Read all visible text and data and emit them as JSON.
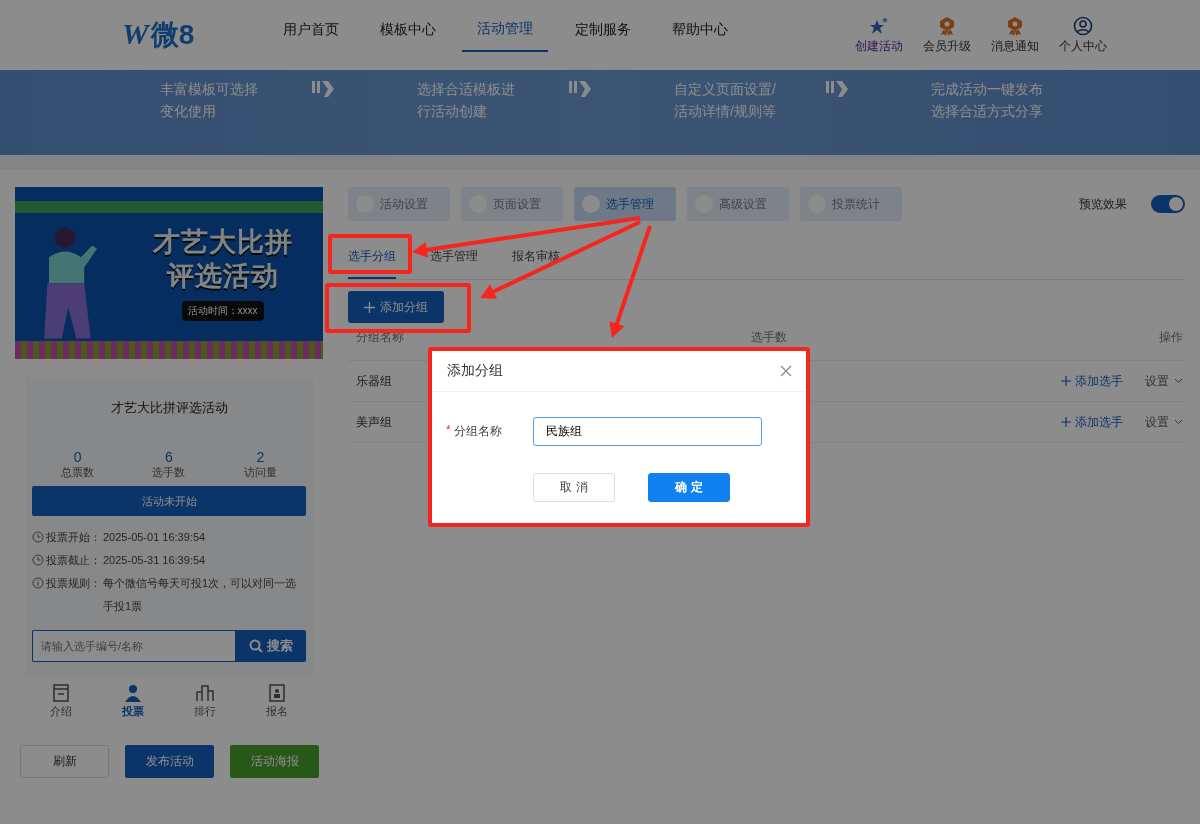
{
  "header": {
    "logo_mark": "W",
    "logo_text": "微8",
    "nav": [
      {
        "label": "用户首页",
        "selected": false
      },
      {
        "label": "模板中心",
        "selected": false
      },
      {
        "label": "活动管理",
        "selected": true
      },
      {
        "label": "定制服务",
        "selected": false
      },
      {
        "label": "帮助中心",
        "selected": false
      }
    ],
    "actions": [
      {
        "kind": "star",
        "label": "创建活动"
      },
      {
        "kind": "badge",
        "label": "会员升级"
      },
      {
        "kind": "badge",
        "label": "消息通知"
      },
      {
        "kind": "user",
        "label": "个人中心"
      }
    ]
  },
  "steps": [
    {
      "lines": [
        "丰富模板可选择",
        "变化使用"
      ]
    },
    {
      "lines": [
        "选择合适模板进",
        "行活动创建"
      ]
    },
    {
      "lines": [
        "自定义页面设置/",
        "活动详情/规则等"
      ]
    },
    {
      "lines": [
        "完成活动一键发布",
        "选择合适方式分享"
      ]
    }
  ],
  "preview": {
    "poster": {
      "title_lines": [
        "才艺大比拼",
        "评选活动"
      ],
      "time": "活动时间：xxxx"
    },
    "title": "才艺大比拼评选活动",
    "stats": [
      {
        "value": "0",
        "label": "总票数"
      },
      {
        "value": "6",
        "label": "选手数"
      },
      {
        "value": "2",
        "label": "访问量"
      }
    ],
    "status": "活动未开始",
    "info": [
      {
        "kind": "clock",
        "label": "投票开始：",
        "value": "2025-05-01 16:39:54"
      },
      {
        "kind": "clock",
        "label": "投票截止：",
        "value": "2025-05-31 16:39:54"
      },
      {
        "kind": "info",
        "label": "投票规则：",
        "value": "每个微信号每天可投1次，可以对同一选手投1票"
      }
    ],
    "search": {
      "placeholder": "请输入选手编号/名称",
      "button": "搜索"
    },
    "tabs": [
      {
        "kind": "intro",
        "label": "介绍",
        "selected": false
      },
      {
        "kind": "vote",
        "label": "投票",
        "selected": true
      },
      {
        "kind": "rank",
        "label": "排行",
        "selected": false
      },
      {
        "kind": "signup",
        "label": "报名",
        "selected": false
      }
    ],
    "buttons": [
      {
        "kind": "plain",
        "label": "刷新"
      },
      {
        "kind": "primary",
        "label": "发布活动"
      },
      {
        "kind": "success",
        "label": "活动海报"
      }
    ]
  },
  "settings": {
    "tabs": [
      {
        "label": "活动设置",
        "selected": false
      },
      {
        "label": "页面设置",
        "selected": false
      },
      {
        "label": "选手管理",
        "selected": true
      },
      {
        "label": "高级设置",
        "selected": false
      },
      {
        "label": "投票统计",
        "selected": false
      }
    ],
    "preview_toggle": {
      "label": "预览效果",
      "on": true
    },
    "subtabs": [
      {
        "label": "选手分组",
        "selected": true
      },
      {
        "label": "选手管理",
        "selected": false
      },
      {
        "label": "报名审核",
        "selected": false
      }
    ],
    "add_button": "添加分组",
    "table": {
      "columns": [
        "分组名称",
        "选手数",
        "操作"
      ],
      "rows": [
        {
          "name": "乐器组",
          "add_player": "添加选手",
          "settings": "设置"
        },
        {
          "name": "美声组",
          "add_player": "添加选手",
          "settings": "设置"
        }
      ]
    }
  },
  "dialog": {
    "title": "添加分组",
    "field": {
      "required_mark": "*",
      "label": "分组名称",
      "value": "民族组"
    },
    "buttons": [
      {
        "kind": "cancel",
        "label": "取 消"
      },
      {
        "kind": "confirm",
        "label": "确 定"
      }
    ]
  }
}
